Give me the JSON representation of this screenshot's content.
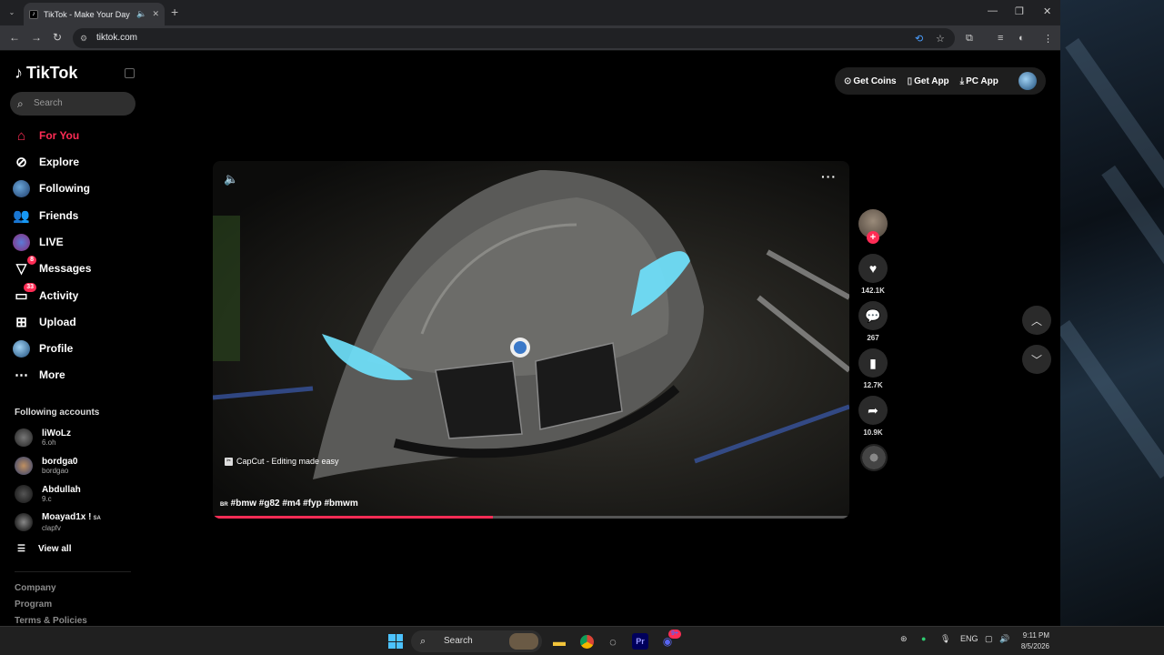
{
  "browser": {
    "tab_title": "TikTok - Make Your Day",
    "url": "tiktok.com"
  },
  "sidebar": {
    "brand": "TikTok",
    "search_placeholder": "Search",
    "nav": [
      {
        "label": "For You",
        "icon": "home-icon",
        "active": true
      },
      {
        "label": "Explore",
        "icon": "compass-icon"
      },
      {
        "label": "Following",
        "icon": "following-avatar"
      },
      {
        "label": "Friends",
        "icon": "friends-icon"
      },
      {
        "label": "LIVE",
        "icon": "live-icon"
      },
      {
        "label": "Messages",
        "icon": "messages-icon",
        "badge": "8"
      },
      {
        "label": "Activity",
        "icon": "activity-icon",
        "badge": "33"
      },
      {
        "label": "Upload",
        "icon": "upload-icon"
      },
      {
        "label": "Profile",
        "icon": "profile-avatar"
      },
      {
        "label": "More",
        "icon": "more-icon"
      }
    ],
    "following_title": "Following accounts",
    "accounts": [
      {
        "name": "liWoLz",
        "sub": "6.oh"
      },
      {
        "name": "bordga0",
        "sub": "bordgao"
      },
      {
        "name": "Abdullah",
        "sub": "9.c"
      },
      {
        "name": "Moayad1x !",
        "sub": "clapfv",
        "flag": "SA"
      }
    ],
    "view_all": "View all",
    "footer": [
      "Company",
      "Program",
      "Terms & Policies"
    ]
  },
  "header": {
    "get_coins": "Get Coins",
    "get_app": "Get App",
    "pc_app": "PC App"
  },
  "video": {
    "effect_label": "CapCut - Editing made easy",
    "prefix": "BR",
    "hashtags": "#bmw #g82 #m4 #fyp #bmwm",
    "progress": 0.44
  },
  "actions": {
    "likes": "142.1K",
    "comments": "267",
    "saves": "12.7K",
    "shares": "10.9K"
  },
  "taskbar": {
    "search": "Search",
    "lang": "ENG",
    "time": "9:11 PM",
    "date": "8/5/2026",
    "discord_badge": "9+"
  },
  "colors": {
    "accent": "#fe2c55",
    "background": "#000000"
  }
}
